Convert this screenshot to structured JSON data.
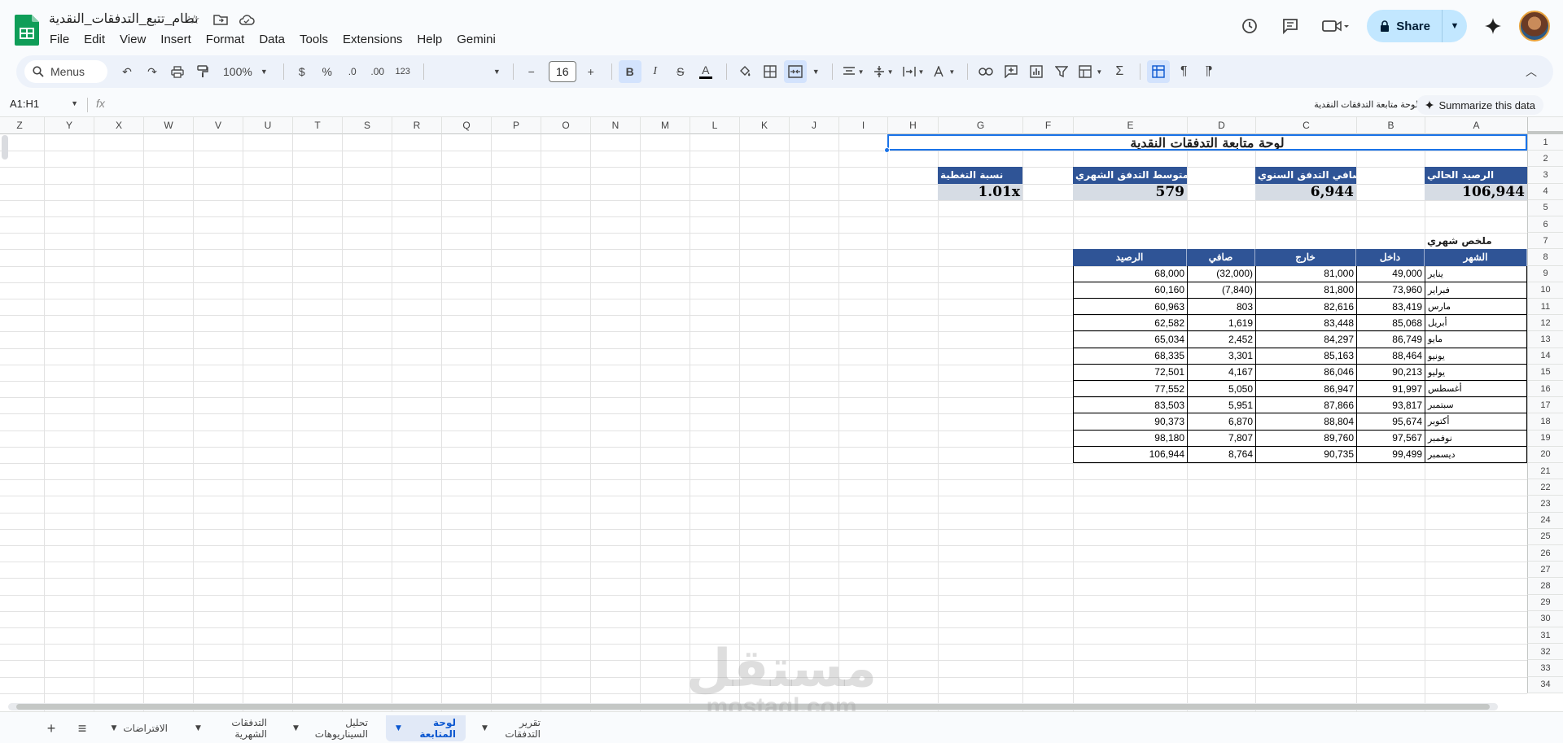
{
  "app": {
    "doc_title": "نظام_تتبع_التدفقات_النقدية",
    "menu": [
      "File",
      "Edit",
      "View",
      "Insert",
      "Format",
      "Data",
      "Tools",
      "Extensions",
      "Help",
      "Gemini"
    ],
    "share_label": "Share"
  },
  "toolbar": {
    "menus_label": "Menus",
    "zoom": "100%",
    "currency": "$",
    "percent": "%",
    "dec_decrease": ".0",
    "dec_increase": ".00",
    "number_format": "123",
    "font_size": "16",
    "bold": "B",
    "italic": "I",
    "strike": "S",
    "text_color": "A"
  },
  "formula_bar": {
    "name_box": "A1:H1",
    "fx": "fx",
    "content": "لوحة متابعة التدفقات النقدية",
    "summarize_label": "Summarize this data"
  },
  "grid": {
    "columns": [
      "Z",
      "Y",
      "X",
      "W",
      "V",
      "U",
      "T",
      "S",
      "R",
      "Q",
      "P",
      "O",
      "N",
      "M",
      "L",
      "K",
      "J",
      "I",
      "H",
      "G",
      "F",
      "E",
      "D",
      "C",
      "B",
      "A"
    ],
    "rows": [
      "1",
      "2",
      "3",
      "4",
      "5",
      "6",
      "7",
      "8",
      "9",
      "10",
      "11",
      "12",
      "13",
      "14",
      "15",
      "16",
      "17",
      "18",
      "19",
      "20",
      "21",
      "22",
      "23",
      "24",
      "25",
      "26",
      "27",
      "28",
      "29",
      "30",
      "31",
      "32",
      "33",
      "34"
    ]
  },
  "dashboard": {
    "title": "لوحة متابعة التدفقات النقدية",
    "kpis": [
      {
        "label": "الرصيد الحالي",
        "value": "106,944"
      },
      {
        "label": "صافي التدفق السنوي",
        "value": "6,944"
      },
      {
        "label": "متوسط التدفق الشهري",
        "value": "579"
      },
      {
        "label": "نسبة التغطية",
        "value": "1.01x"
      }
    ],
    "summary_title": "ملخص شهري",
    "table_headers": [
      "الشهر",
      "داخل",
      "خارج",
      "صافي",
      "الرصيد"
    ],
    "table_rows": [
      [
        "يناير",
        "49,000",
        "81,000",
        "(32,000)",
        "68,000"
      ],
      [
        "فبراير",
        "73,960",
        "81,800",
        "(7,840)",
        "60,160"
      ],
      [
        "مارس",
        "83,419",
        "82,616",
        "803",
        "60,963"
      ],
      [
        "أبريل",
        "85,068",
        "83,448",
        "1,619",
        "62,582"
      ],
      [
        "مايو",
        "86,749",
        "84,297",
        "2,452",
        "65,034"
      ],
      [
        "يونيو",
        "88,464",
        "85,163",
        "3,301",
        "68,335"
      ],
      [
        "يوليو",
        "90,213",
        "86,046",
        "4,167",
        "72,501"
      ],
      [
        "أغسطس",
        "91,997",
        "86,947",
        "5,050",
        "77,552"
      ],
      [
        "سبتمبر",
        "93,817",
        "87,866",
        "5,951",
        "83,503"
      ],
      [
        "أكتوبر",
        "95,674",
        "88,804",
        "6,870",
        "90,373"
      ],
      [
        "نوفمبر",
        "97,567",
        "89,760",
        "7,807",
        "98,180"
      ],
      [
        "ديسمبر",
        "99,499",
        "90,735",
        "8,764",
        "106,944"
      ]
    ]
  },
  "sheets": [
    {
      "name": "تقرير التدفقات",
      "active": false
    },
    {
      "name": "لوحة المتابعة",
      "active": true
    },
    {
      "name": "تحليل السيناريوهات",
      "active": false
    },
    {
      "name": "التدفقات الشهرية",
      "active": false
    },
    {
      "name": "الافتراضات",
      "active": false
    }
  ],
  "watermark": {
    "arabic": "مستقل",
    "latin": "mostaql.com"
  },
  "colors": {
    "header_blue": "#2f5496",
    "kpi_gray": "#d6dce4",
    "selection": "#1a73e8",
    "share_bg": "#c2e7ff"
  }
}
